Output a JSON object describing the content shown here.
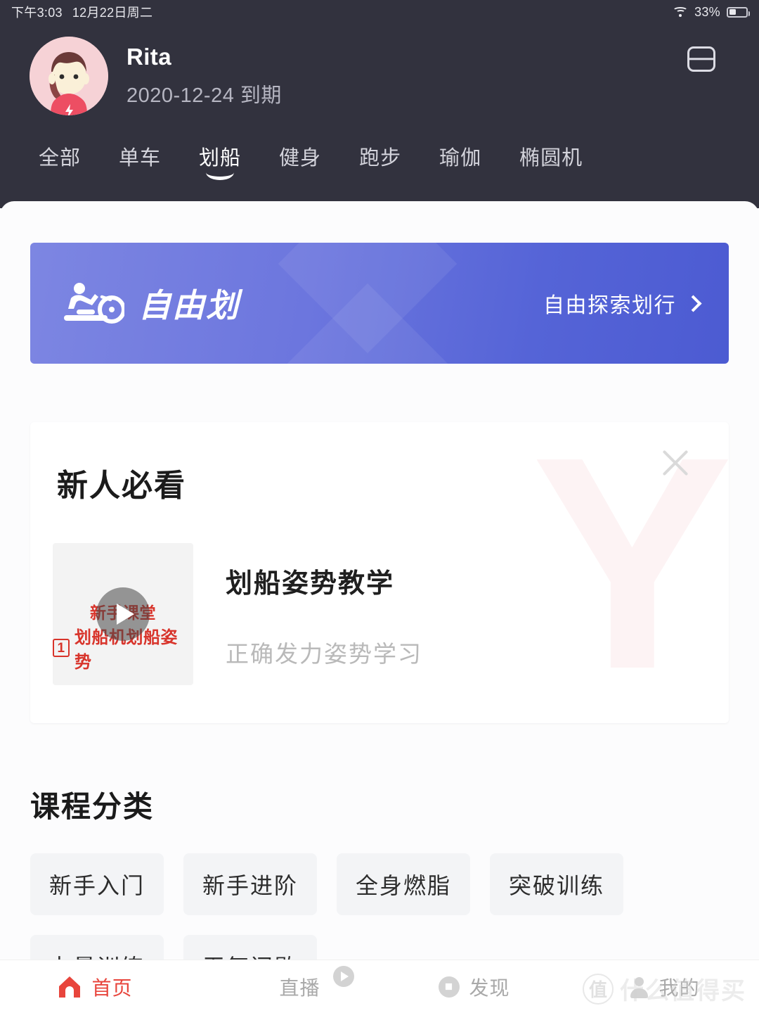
{
  "status_bar": {
    "time": "下午3:03",
    "date": "12月22日周二",
    "battery_percent": "33%",
    "wifi_icon": "wifi-icon",
    "battery_icon": "battery-icon"
  },
  "header": {
    "user_name": "Rita",
    "expiry_text": "2020-12-24 到期",
    "avatar_icon": "user-avatar",
    "scan_icon": "scan-card-icon",
    "background_color": "#32323E"
  },
  "tabs": {
    "active_index": 2,
    "items": [
      {
        "label": "全部"
      },
      {
        "label": "单车"
      },
      {
        "label": "划船"
      },
      {
        "label": "健身"
      },
      {
        "label": "跑步"
      },
      {
        "label": "瑜伽"
      },
      {
        "label": "椭圆机"
      }
    ]
  },
  "banner": {
    "title": "自由划",
    "cta": "自由探索划行",
    "chevron_icon": "chevron-right-icon",
    "rowing_icon": "rowing-machine-icon",
    "gradient_from": "#7D86E2",
    "gradient_to": "#4C5BD2"
  },
  "beginner_card": {
    "title": "新人必看",
    "close_icon": "close-icon",
    "watermark": "Y",
    "lesson": {
      "thumbnail": {
        "line1": "新手课堂",
        "number": "1",
        "line2": "划船机划船姿势",
        "play_icon": "play-icon",
        "text_color": "#D8342B"
      },
      "title": "划船姿势教学",
      "subtitle": "正确发力姿势学习"
    }
  },
  "categories": {
    "title": "课程分类",
    "chips": [
      {
        "label": "新手入门"
      },
      {
        "label": "新手进阶"
      },
      {
        "label": "全身燃脂"
      },
      {
        "label": "突破训练"
      },
      {
        "label": "力量训练"
      },
      {
        "label": "无氧间歇"
      }
    ]
  },
  "tabbar": {
    "active_index": 0,
    "active_color": "#E8453C",
    "items": [
      {
        "label": "首页",
        "icon": "home-icon"
      },
      {
        "label": "直播",
        "icon": "live-play-icon"
      },
      {
        "label": "发现",
        "icon": "compass-icon"
      },
      {
        "label": "我的",
        "icon": "person-icon"
      }
    ]
  },
  "watermark": {
    "logo_char": "值",
    "text": "什么值得买"
  }
}
